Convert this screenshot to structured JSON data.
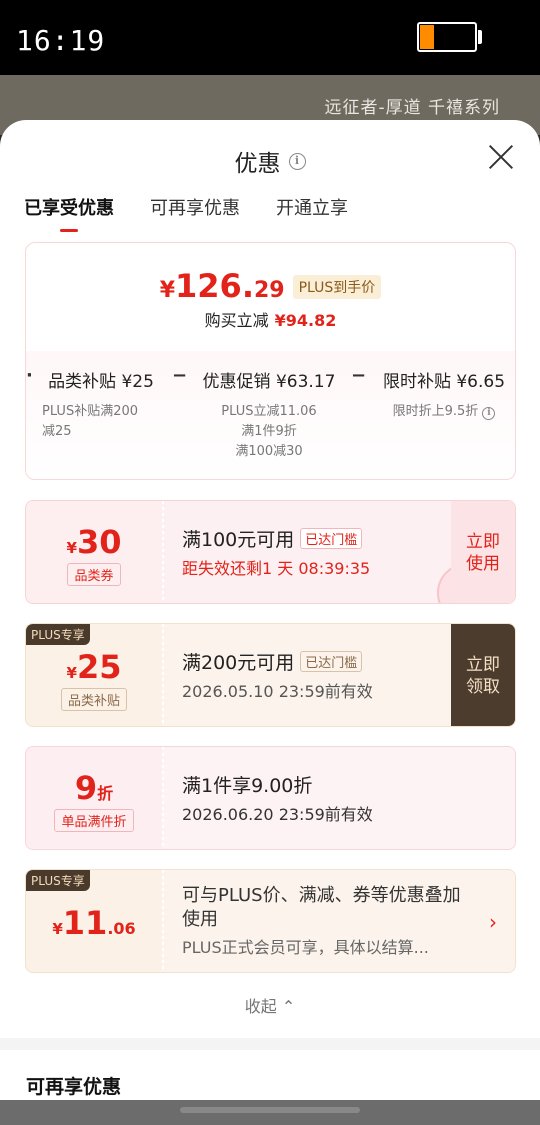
{
  "status_bar": {
    "time": "16:19",
    "battery_level": 0.25,
    "battery_icon": "battery-icon"
  },
  "background": {
    "product_subtitle": "远征者-厚道 千禧系列"
  },
  "sheet": {
    "title": "优惠",
    "info_icon": "info-icon",
    "close_icon": "close-icon",
    "tabs": [
      {
        "label": "已享受优惠",
        "active": true
      },
      {
        "label": "可再享优惠",
        "active": false
      },
      {
        "label": "开通立享",
        "active": false
      }
    ]
  },
  "summary": {
    "currency": "¥",
    "final_price_int": "126.",
    "final_price_dec": "29",
    "plus_tag": "PLUS到手价",
    "discount_label": "购买立减",
    "discount_amount": "¥94.82",
    "breakdown": [
      {
        "main": "品类补贴 ¥25",
        "sub": [
          "PLUS补贴满200",
          "减25"
        ]
      },
      {
        "main": "优惠促销 ¥63.17",
        "sub": [
          "PLUS立减11.06",
          "满1件9折",
          "满100减30"
        ]
      },
      {
        "main": "限时补贴 ¥6.65",
        "sub": [
          "限时折上9.5折"
        ]
      }
    ],
    "operator": "−",
    "sub_info_icon": "info-icon"
  },
  "coupons": [
    {
      "symbol": "¥",
      "amount": "30",
      "type": "品类券",
      "condition": "满100元可用",
      "threshold": "已达门槛",
      "expire": "距失效还剩1 天 08:39:35",
      "action": [
        "立即",
        "使用"
      ]
    },
    {
      "badge": "PLUS专享",
      "symbol": "¥",
      "amount": "25",
      "type": "品类补贴",
      "condition": "满200元可用",
      "threshold": "已达门槛",
      "expire": "2026.05.10 23:59前有效",
      "action": [
        "立即",
        "领取"
      ]
    },
    {
      "amount": "9",
      "unit": "折",
      "type": "单品满件折",
      "condition": "满1件享9.00折",
      "expire": "2026.06.20 23:59前有效"
    },
    {
      "badge": "PLUS专享",
      "symbol": "¥",
      "amount_int": "11",
      "amount_dec": ".06",
      "line1": "可与PLUS价、满减、券等优惠叠加使用",
      "line2": "PLUS正式会员可享，具体以结算...",
      "chevron": "›"
    }
  ],
  "collapse_label": "收起 ⌃",
  "section2_title": "可再享优惠"
}
